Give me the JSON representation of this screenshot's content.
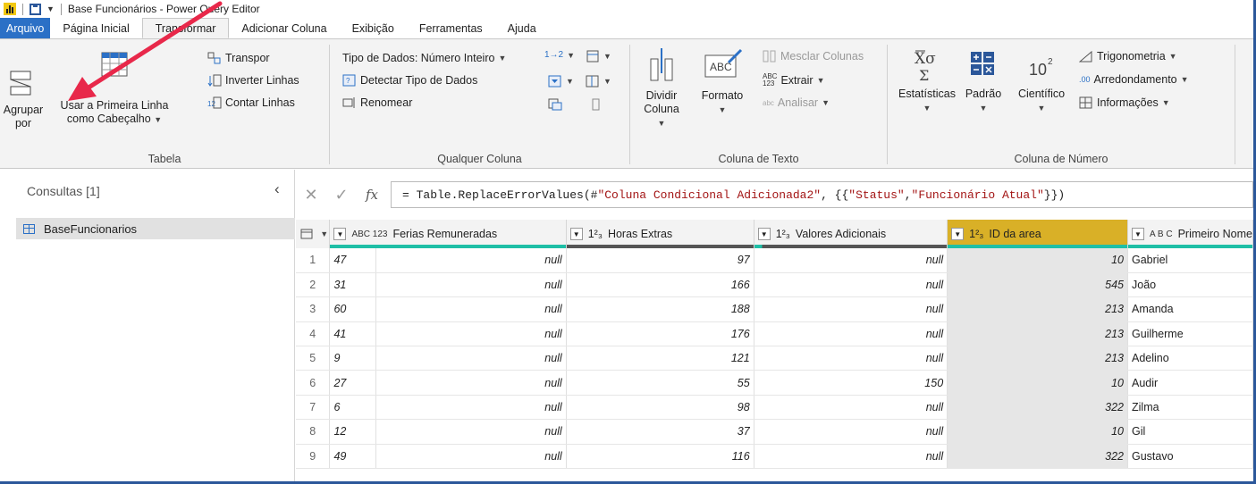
{
  "window": {
    "title": "Base Funcionários - Power Query Editor"
  },
  "tabs": [
    {
      "label": "Arquivo",
      "state": "file"
    },
    {
      "label": "Página Inicial",
      "state": "normal"
    },
    {
      "label": "Transformar",
      "state": "active"
    },
    {
      "label": "Adicionar Coluna",
      "state": "normal"
    },
    {
      "label": "Exibição",
      "state": "normal"
    },
    {
      "label": "Ferramentas",
      "state": "normal"
    },
    {
      "label": "Ajuda",
      "state": "normal"
    }
  ],
  "ribbon": {
    "tabela": {
      "label": "Tabela",
      "agrupar_l1": "Agrupar",
      "agrupar_l2": "por",
      "primeira_l1": "Usar a Primeira Linha",
      "primeira_l2": "como Cabeçalho",
      "transpor": "Transpor",
      "inverter": "Inverter Linhas",
      "contar": "Contar Linhas"
    },
    "qualquer": {
      "label": "Qualquer Coluna",
      "tipo": "Tipo de Dados: Número Inteiro",
      "detectar": "Detectar Tipo de Dados",
      "renomear": "Renomear"
    },
    "texto": {
      "label": "Coluna de Texto",
      "dividir_l1": "Dividir",
      "dividir_l2": "Coluna",
      "formato": "Formato",
      "mesclar": "Mesclar Colunas",
      "extrair": "Extrair",
      "analisar": "Analisar"
    },
    "numero": {
      "label": "Coluna de Número",
      "estatisticas": "Estatísticas",
      "padrao": "Padrão",
      "cientifico": "Científico",
      "trigonometria": "Trigonometria",
      "arredondamento": "Arredondamento",
      "informacoes": "Informações"
    }
  },
  "queries": {
    "header": "Consultas [1]",
    "items": [
      "BaseFuncionarios"
    ]
  },
  "formula": {
    "prefix": "= Table.ReplaceErrorValues(#",
    "s1": "\"Coluna Condicional Adicionada2\"",
    "mid": ", {{",
    "s2": "\"Status\"",
    "comma": ", ",
    "s3": "\"Funcionário Atual\"",
    "suffix": "}})"
  },
  "grid": {
    "columns": [
      {
        "type": "ABC 123",
        "name": "Ferias Remuneradas"
      },
      {
        "type": "1²₃",
        "name": "Horas Extras"
      },
      {
        "type": "1²₃",
        "name": "Valores Adicionais"
      },
      {
        "type": "1²₃",
        "name": "ID da area"
      },
      {
        "type": "A B C",
        "name": "Primeiro Nome"
      }
    ],
    "rows": [
      {
        "i": "1",
        "a": "47",
        "b": "null",
        "c": "97",
        "d": "null",
        "e": "10",
        "f": "Gabriel"
      },
      {
        "i": "2",
        "a": "31",
        "b": "null",
        "c": "166",
        "d": "null",
        "e": "545",
        "f": "João"
      },
      {
        "i": "3",
        "a": "60",
        "b": "null",
        "c": "188",
        "d": "null",
        "e": "213",
        "f": "Amanda"
      },
      {
        "i": "4",
        "a": "41",
        "b": "null",
        "c": "176",
        "d": "null",
        "e": "213",
        "f": "Guilherme"
      },
      {
        "i": "5",
        "a": "9",
        "b": "null",
        "c": "121",
        "d": "null",
        "e": "213",
        "f": "Adelino"
      },
      {
        "i": "6",
        "a": "27",
        "b": "null",
        "c": "55",
        "d": "150",
        "e": "10",
        "f": "Audir"
      },
      {
        "i": "7",
        "a": "6",
        "b": "null",
        "c": "98",
        "d": "null",
        "e": "322",
        "f": "Zilma"
      },
      {
        "i": "8",
        "a": "12",
        "b": "null",
        "c": "37",
        "d": "null",
        "e": "10",
        "f": "Gil"
      },
      {
        "i": "9",
        "a": "49",
        "b": "null",
        "c": "116",
        "d": "null",
        "e": "322",
        "f": "Gustavo"
      }
    ]
  },
  "colors": {
    "accent": "#2b579a",
    "file_tab": "#2b70c6",
    "selected_column": "#d9b027",
    "quality_bar": "#1fbfa6",
    "annotation_arrow": "#e8284a"
  }
}
